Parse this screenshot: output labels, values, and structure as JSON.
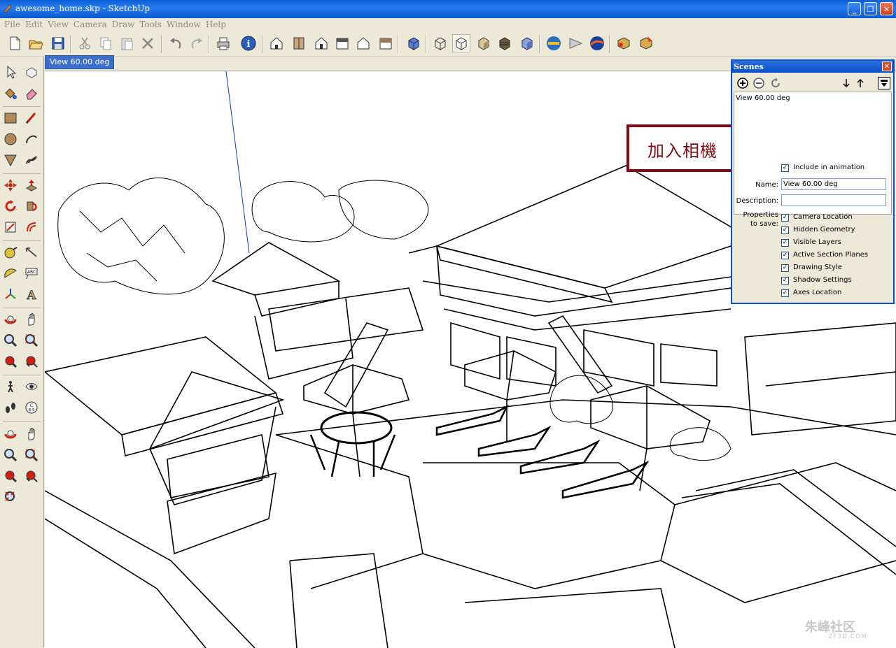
{
  "window": {
    "title": "awesome_home.skp - SketchUp",
    "minimize": "_",
    "maximize": "❐",
    "close": "✕"
  },
  "menu": [
    "File",
    "Edit",
    "View",
    "Camera",
    "Draw",
    "Tools",
    "Window",
    "Help"
  ],
  "toolbar_icons": [
    "new-icon",
    "open-icon",
    "save-icon",
    "cut-icon",
    "copy-icon",
    "paste-icon",
    "erase-icon",
    "undo-icon",
    "redo-icon",
    "print-icon",
    "model-info-icon",
    "iso-view-icon",
    "top-view-icon",
    "front-view-icon",
    "right-view-icon",
    "back-view-icon",
    "left-view-icon",
    "xray-icon",
    "wireframe-icon",
    "hidden-line-icon",
    "shaded-icon",
    "shaded-texture-icon",
    "monochrome-icon",
    "get-models-icon",
    "share-model-icon",
    "google-earth-icon",
    "component-icon",
    "component-share-icon"
  ],
  "left_toolbar_icons": [
    "select-icon",
    "make-component-icon",
    "paint-bucket-icon",
    "eraser-icon",
    "rectangle-icon",
    "line-icon",
    "circle-icon",
    "arc-icon",
    "polygon-icon",
    "freehand-icon",
    "move-icon",
    "push-pull-icon",
    "rotate-icon",
    "follow-me-icon",
    "scale-icon",
    "offset-icon",
    "tape-measure-icon",
    "dimension-icon",
    "protractor-icon",
    "text-icon",
    "axes-icon",
    "3d-text-icon",
    "orbit-icon",
    "pan-icon",
    "zoom-icon",
    "zoom-window-icon",
    "previous-view-icon",
    "zoom-extents-icon",
    "walk-icon",
    "look-around-icon",
    "position-camera-icon",
    "section-plane-icon",
    "orbit2-icon",
    "pan2-icon",
    "zoom2-icon",
    "zoom-window2-icon",
    "previous2-icon",
    "next-view-icon",
    "zoom-extents2-icon"
  ],
  "scene_tab": "View 60.00 deg",
  "scenes_panel": {
    "title": "Scenes",
    "list": [
      "View 60.00 deg"
    ],
    "include_in_animation": "Include in animation",
    "name_label": "Name:",
    "name_value": "View 60.00 deg",
    "description_label": "Description:",
    "description_value": "",
    "properties_label_1": "Properties",
    "properties_label_2": "to save:",
    "properties": [
      "Camera Location",
      "Hidden Geometry",
      "Visible Layers",
      "Active Section Planes",
      "Drawing Style",
      "Shadow Settings",
      "Axes Location"
    ],
    "checked": "✓"
  },
  "annotation": "加入相機",
  "watermark": "朱峰社区",
  "watermark_sub": "ZF3D.COM",
  "colors": {
    "title_blue": "#0a5fd8",
    "chrome": "#ece9d8",
    "annotation": "#7a0e16",
    "scene_tab": "#3b6fc9"
  }
}
